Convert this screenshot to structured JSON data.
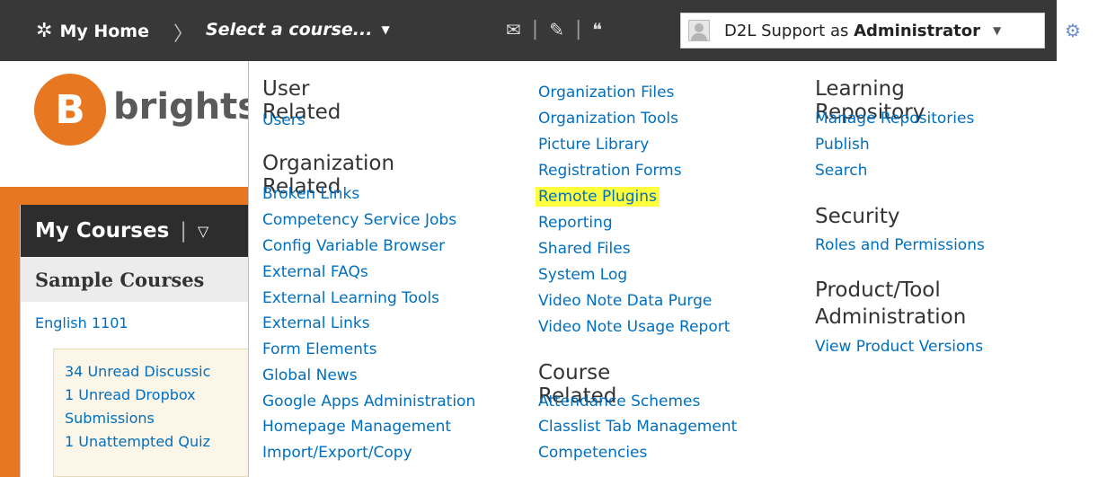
{
  "navbar": {
    "home_label": "My Home",
    "course_select": "Select a course...",
    "user_label_prefix": "D2L Support as ",
    "user_label_role": "Administrator"
  },
  "background": {
    "brand_name": "brights",
    "logo_letter": "B",
    "my_courses": "My Courses",
    "sample_courses": "Sample Courses",
    "course_link": "English 1101",
    "updates": [
      "34 Unread Discussic",
      "1 Unread Dropbox",
      "Submissions",
      "1 Unattempted Quiz"
    ]
  },
  "admin_menu": {
    "col1": {
      "h_user": "User Related",
      "user_links": [
        "Users"
      ],
      "h_org": "Organization Related",
      "org_links": [
        "Broken Links",
        "Competency Service Jobs",
        "Config Variable Browser",
        "External FAQs",
        "External Learning Tools",
        "External Links",
        "Form Elements",
        "Global News",
        "Google Apps Administration",
        "Homepage Management",
        "Import/Export/Copy"
      ]
    },
    "col2": {
      "org_links": [
        "Organization Files",
        "Organization Tools",
        "Picture Library",
        "Registration Forms",
        "Remote Plugins",
        "Reporting",
        "Shared Files",
        "System Log",
        "Video Note Data Purge",
        "Video Note Usage Report"
      ],
      "h_course": "Course Related",
      "course_links": [
        "Attendance Schemes",
        "Classlist Tab Management",
        "Competencies"
      ]
    },
    "col3": {
      "h_repo": "Learning Repository",
      "repo_links": [
        "Manage Repositories",
        "Publish",
        "Search"
      ],
      "h_security": "Security",
      "security_links": [
        "Roles and Permissions"
      ],
      "h_product_1": "Product/Tool",
      "h_product_2": "Administration",
      "product_links": [
        "View Product Versions"
      ]
    }
  }
}
